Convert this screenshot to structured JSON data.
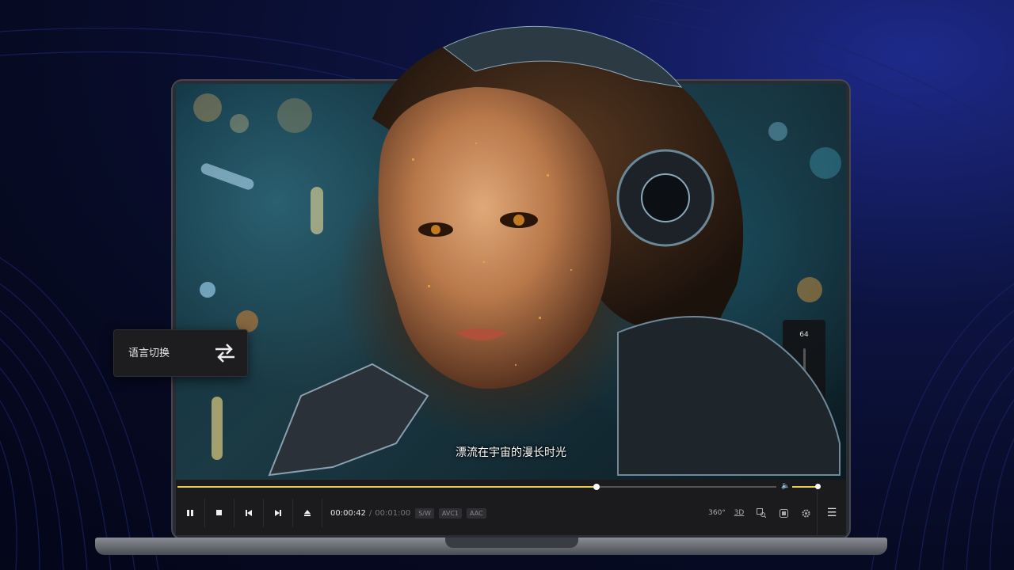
{
  "player": {
    "subtitle": "漂流在宇宙的漫长时光",
    "current_time": "00:00:42",
    "separator": "/",
    "total_time": "00:01:00",
    "progress": 0.7,
    "tags": [
      "S/W",
      "AVC1",
      "AAC"
    ],
    "volume_value": "64",
    "volume_level": 0.64,
    "mini_volume_level": 0.95,
    "controls": [
      "pause-icon",
      "stop-icon",
      "previous-icon",
      "next-icon",
      "eject-icon"
    ],
    "right_icons": [
      {
        "icon": "vr-360-icon",
        "label": "360°"
      },
      {
        "icon": "3d-icon",
        "label": "3D"
      },
      {
        "icon": "zoom-icon",
        "label": ""
      },
      {
        "icon": "capture-icon",
        "label": ""
      },
      {
        "icon": "settings-icon",
        "label": ""
      }
    ],
    "menu_icon": "menu-icon"
  },
  "language_panel": {
    "label": "语言切换",
    "icon": "swap-arrows-icon"
  },
  "colors": {
    "accent": "#f5d90a",
    "background": "#060a22",
    "panel": "#1b1b1e"
  }
}
